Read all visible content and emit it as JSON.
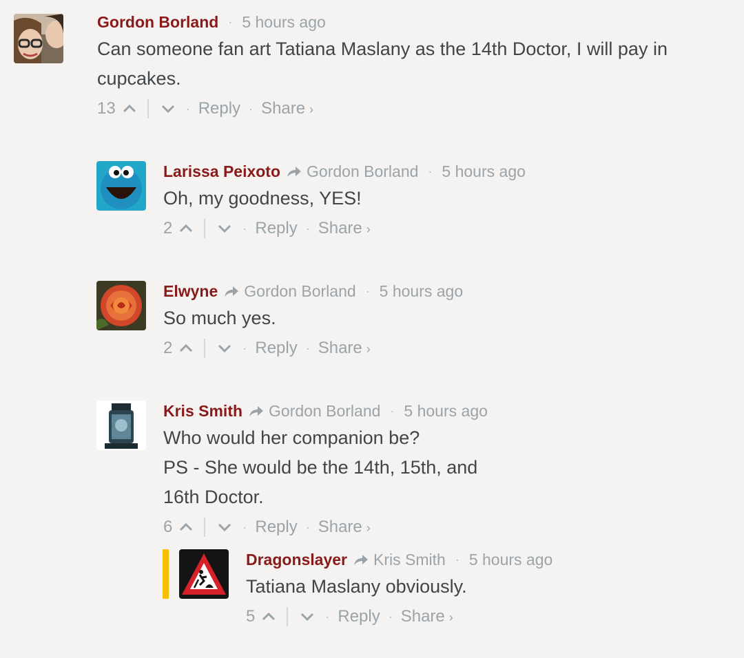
{
  "comments": [
    {
      "author": "Gordon Borland",
      "reply_to": "",
      "time": "5 hours ago",
      "text": "Can someone fan art Tatiana Maslany as the 14th Doctor, I will pay in\ncupcakes.",
      "votes": "13",
      "reply_label": "Reply",
      "share_label": "Share",
      "avatar": "photo-woman-glasses-icon"
    },
    {
      "author": "Larissa Peixoto",
      "reply_to": "Gordon Borland",
      "time": "5 hours ago",
      "text": "Oh, my goodness, YES!",
      "votes": "2",
      "reply_label": "Reply",
      "share_label": "Share",
      "avatar": "cookie-monster-icon"
    },
    {
      "author": "Elwyne",
      "reply_to": "Gordon Borland",
      "time": "5 hours ago",
      "text": "So much yes.",
      "votes": "2",
      "reply_label": "Reply",
      "share_label": "Share",
      "avatar": "rose-icon"
    },
    {
      "author": "Kris Smith",
      "reply_to": "Gordon Borland",
      "time": "5 hours ago",
      "text": "Who would her companion be?\nPS - She would be the 14th, 15th, and 16th Doctor.",
      "votes": "6",
      "reply_label": "Reply",
      "share_label": "Share",
      "avatar": "statue-icon"
    },
    {
      "author": "Dragonslayer",
      "reply_to": "Kris Smith",
      "time": "5 hours ago",
      "text": "Tatiana Maslany obviously.",
      "votes": "5",
      "reply_label": "Reply",
      "share_label": "Share",
      "avatar": "roadwork-sign-icon"
    }
  ],
  "colors": {
    "author": "#8a1a1a",
    "meta": "#9aa3a9",
    "text": "#3f4549",
    "background": "#f4f3f1",
    "highlight": "#f6c000"
  }
}
